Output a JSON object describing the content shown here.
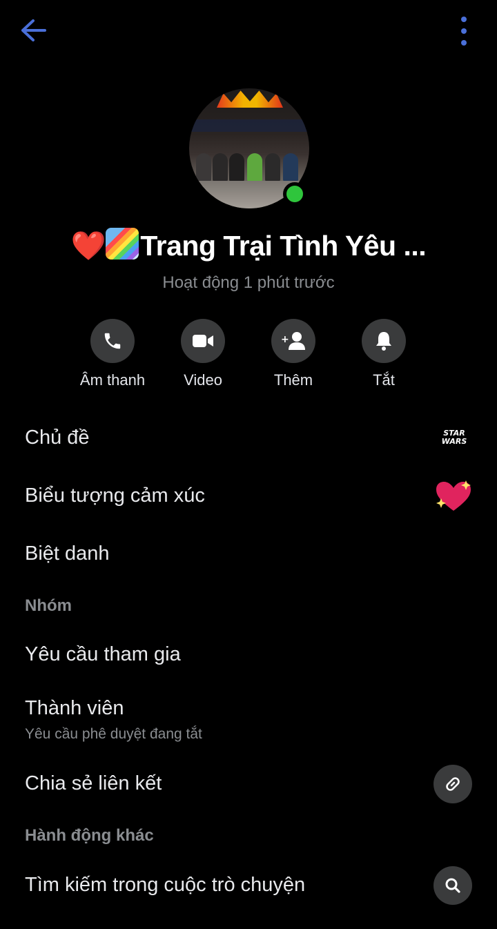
{
  "header": {
    "back_icon": "arrow-left-icon",
    "more_icon": "more-vertical-icon"
  },
  "profile": {
    "name_emoji_1": "❤️",
    "name_emoji_2": "🌈",
    "name": "Trang Trại Tình Yêu ...",
    "status": "Hoạt động 1 phút trước",
    "online_color": "#2fc53c"
  },
  "actions": [
    {
      "label": "Âm thanh",
      "icon": "phone-icon"
    },
    {
      "label": "Video",
      "icon": "video-camera-icon"
    },
    {
      "label": "Thêm",
      "icon": "add-person-icon"
    },
    {
      "label": "Tắt",
      "icon": "bell-icon"
    }
  ],
  "settings": {
    "theme_label": "Chủ đề",
    "theme_value_line1": "STAR",
    "theme_value_line2": "WARS",
    "emoji_label": "Biểu tượng cảm xúc",
    "emoji_value": "sparkling-heart-icon",
    "nickname_label": "Biệt danh"
  },
  "group": {
    "section_title": "Nhóm",
    "join_requests": "Yêu cầu tham gia",
    "members": "Thành viên",
    "members_sub": "Yêu cầu phê duyệt đang tắt",
    "share_link": "Chia sẻ liên kết"
  },
  "more_actions": {
    "section_title": "Hành động khác",
    "search": "Tìm kiếm trong cuộc trò chuyện"
  },
  "colors": {
    "accent": "#4a6fd8",
    "background": "#000000",
    "circle": "#3a3b3c",
    "secondary_text": "#8a8d91"
  }
}
